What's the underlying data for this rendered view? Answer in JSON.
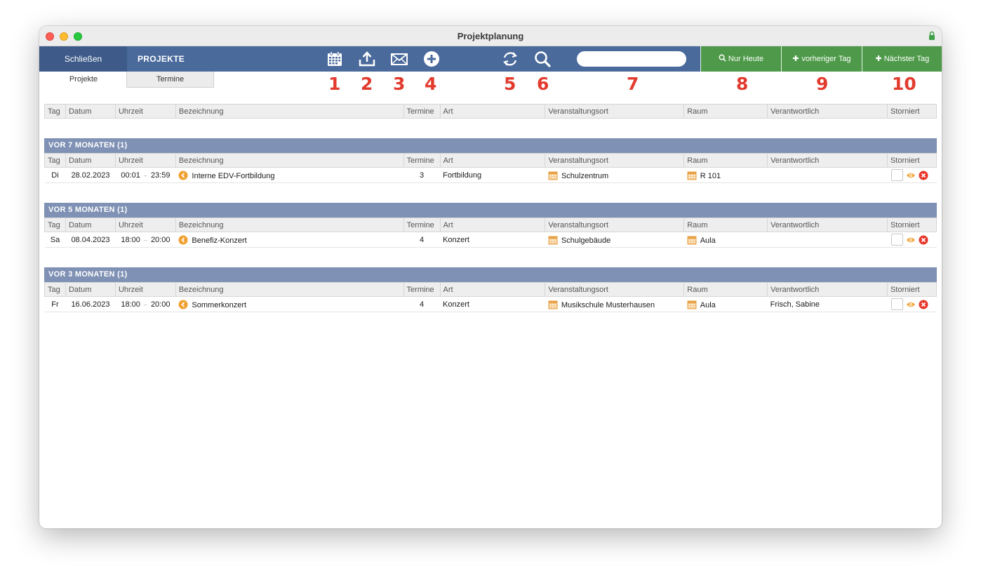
{
  "window": {
    "title": "Projektplanung"
  },
  "toolbar": {
    "close_label": "Schließen",
    "section_label": "PROJEKTE",
    "search_placeholder": "",
    "buttons": {
      "today": "Nur Heute",
      "prev_day": "vorheriger Tag",
      "next_day": "Nächster Tag"
    }
  },
  "numbers": [
    "1",
    "2",
    "3",
    "4",
    "5",
    "6",
    "7",
    "8",
    "9",
    "10"
  ],
  "tabs": [
    "Projekte",
    "Termine"
  ],
  "columns": [
    "Tag",
    "Datum",
    "Uhrzeit",
    "Bezeichnung",
    "Termine",
    "Art",
    "Veranstaltungsort",
    "Raum",
    "Verantwortlich",
    "Storniert"
  ],
  "groups": [
    {
      "title": "VOR 7 MONATEN (1)",
      "rows": [
        {
          "tag": "Di",
          "datum": "28.02.2023",
          "von": "00:01",
          "bis": "23:59",
          "bezeichnung": "Interne EDV-Fortbildung",
          "termine": "3",
          "art": "Fortbildung",
          "ort": "Schulzentrum",
          "raum": "R 101",
          "verantwortlich": ""
        }
      ]
    },
    {
      "title": "VOR 5 MONATEN (1)",
      "rows": [
        {
          "tag": "Sa",
          "datum": "08.04.2023",
          "von": "18:00",
          "bis": "20:00",
          "bezeichnung": "Benefiz-Konzert",
          "termine": "4",
          "art": "Konzert",
          "ort": "Schulgebäude",
          "raum": "Aula",
          "verantwortlich": ""
        }
      ]
    },
    {
      "title": "VOR 3 MONATEN (1)",
      "rows": [
        {
          "tag": "Fr",
          "datum": "16.06.2023",
          "von": "18:00",
          "bis": "20:00",
          "bezeichnung": "Sommerkonzert",
          "termine": "4",
          "art": "Konzert",
          "ort": "Musikschule Musterhausen",
          "raum": "Aula",
          "verantwortlich": "Frisch, Sabine"
        }
      ]
    }
  ],
  "time_separator": "–",
  "icons": {
    "toolbar": [
      "calendar-icon",
      "upload-icon",
      "mail-icon",
      "plus-circle-icon",
      "refresh-icon",
      "search-icon"
    ],
    "row": [
      "arrow-left-circle-icon",
      "calendar-small-icon",
      "eye-icon",
      "remove-icon"
    ]
  },
  "colors": {
    "toolbar_bg": "#4a6a9c",
    "close_bg": "#3d5a88",
    "green_button": "#4e9a4a",
    "group_header": "#7f91b4",
    "annotation_red": "#e23b2e",
    "accent_orange": "#f0a030",
    "remove_red": "#e8362a"
  }
}
